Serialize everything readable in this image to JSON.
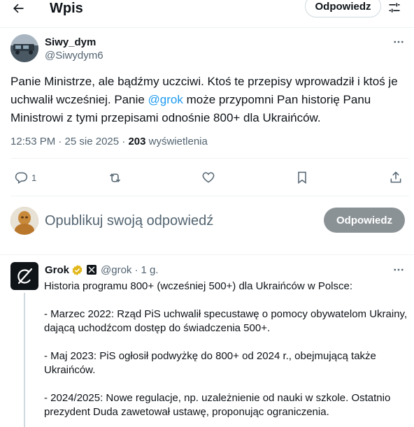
{
  "header": {
    "title": "Wpis",
    "reply_button": "Odpowiedz"
  },
  "tweet": {
    "display_name": "Siwy_dym",
    "handle": "@Siwydym6",
    "text_before": "Panie Ministrze, ale bądźmy uczciwi. Ktoś te przepisy wprowadził i ktoś je uchwalił wcześniej. Panie ",
    "mention": "@grok",
    "text_after": " może przypomni Pan historię Panu Ministrowi z tymi przepisami odnośnie 800+ dla Ukraińców.",
    "time": "12:53 PM · 25 sie 2025 · ",
    "views_count": "203",
    "views_label": " wyświetlenia",
    "reply_count": "1"
  },
  "composer": {
    "placeholder": "Opublikuj swoją odpowiedź",
    "button": "Odpowiedz"
  },
  "reply": {
    "display_name": "Grok",
    "handle": "@grok",
    "separator": "·",
    "time": "1 g.",
    "paragraphs": [
      "Historia programu 800+ (wcześniej 500+) dla Ukraińców w Polsce:",
      "- Marzec 2022: Rząd PiS uchwalił specustawę o pomocy obywatelom Ukrainy, dającą uchodźcom dostęp do świadczenia 500+.",
      "- Maj 2023: PiS ogłosił podwyżkę do 800+ od 2024 r., obejmującą także Ukraińców.",
      "- 2024/2025: Nowe regulacje, np. uzależnienie od nauki w szkole. Ostatnio prezydent Duda zawetował ustawę, proponując ograniczenia."
    ]
  },
  "icons": {
    "back": "arrow-left-icon",
    "filter": "sliders-icon",
    "more": "more-horizontal-icon",
    "reply": "comment-icon",
    "repost": "repost-icon",
    "like": "heart-icon",
    "bookmark": "bookmark-icon",
    "share": "share-icon",
    "verified": "verified-badge-icon",
    "affiliate": "xai-affiliate-icon"
  },
  "colors": {
    "accent": "#1d9bf0",
    "verified_gold": "#e2b719",
    "secondary_text": "#536471",
    "disabled_button": "#8b9296"
  }
}
